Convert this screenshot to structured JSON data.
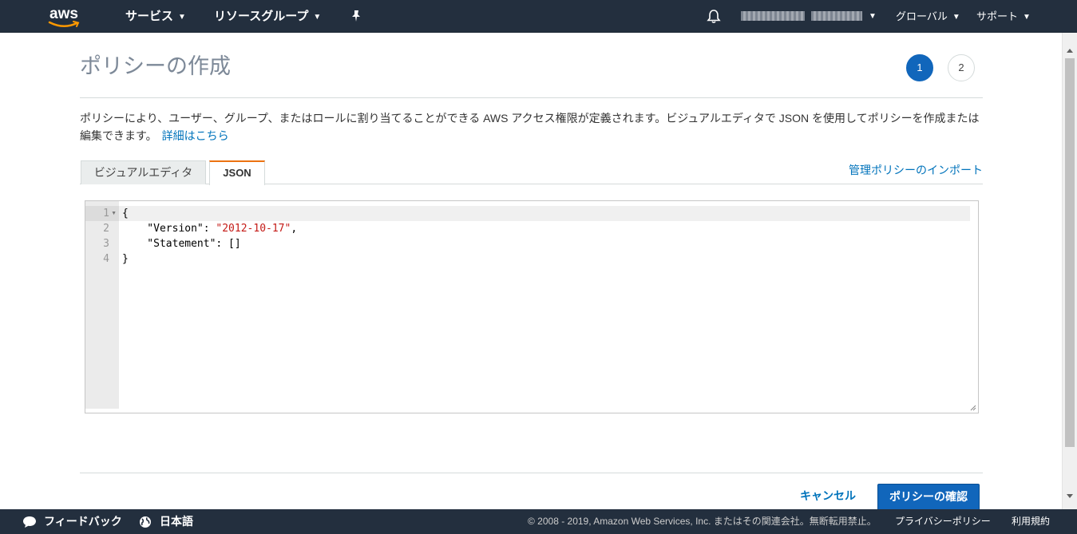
{
  "topnav": {
    "logo_text": "aws",
    "services_label": "サービス",
    "resource_groups_label": "リソースグループ",
    "region_label": "グローバル",
    "support_label": "サポート"
  },
  "page": {
    "title": "ポリシーの作成",
    "steps": [
      "1",
      "2"
    ],
    "active_step": 1,
    "description": "ポリシーにより、ユーザー、グループ、またはロールに割り当てることができる AWS アクセス権限が定義されます。ビジュアルエディタで JSON を使用してポリシーを作成または編集できます。",
    "learn_more_link": "詳細はこちら",
    "tabs": [
      {
        "label": "ビジュアルエディタ",
        "active": false
      },
      {
        "label": "JSON",
        "active": true
      }
    ],
    "import_link": "管理ポリシーのインポート"
  },
  "editor": {
    "line_numbers": [
      "1",
      "2",
      "3",
      "4"
    ],
    "lines": [
      {
        "text": "{"
      },
      {
        "key": "    \"Version\": ",
        "value": "\"2012-10-17\"",
        "suffix": ","
      },
      {
        "text": "    \"Statement\": []"
      },
      {
        "text": "}"
      }
    ]
  },
  "actions": {
    "cancel_label": "キャンセル",
    "primary_label": "ポリシーの確認"
  },
  "footer": {
    "feedback_label": "フィードバック",
    "language_label": "日本語",
    "copyright": "© 2008 - 2019, Amazon Web Services, Inc. またはその関連会社。無断転用禁止。",
    "privacy_link": "プライバシーポリシー",
    "terms_link": "利用規約"
  },
  "colors": {
    "nav_bg": "#232f3e",
    "primary": "#1166bb",
    "link": "#0073bb",
    "tab_accent": "#ec7211",
    "json_string": "#c41a16"
  }
}
